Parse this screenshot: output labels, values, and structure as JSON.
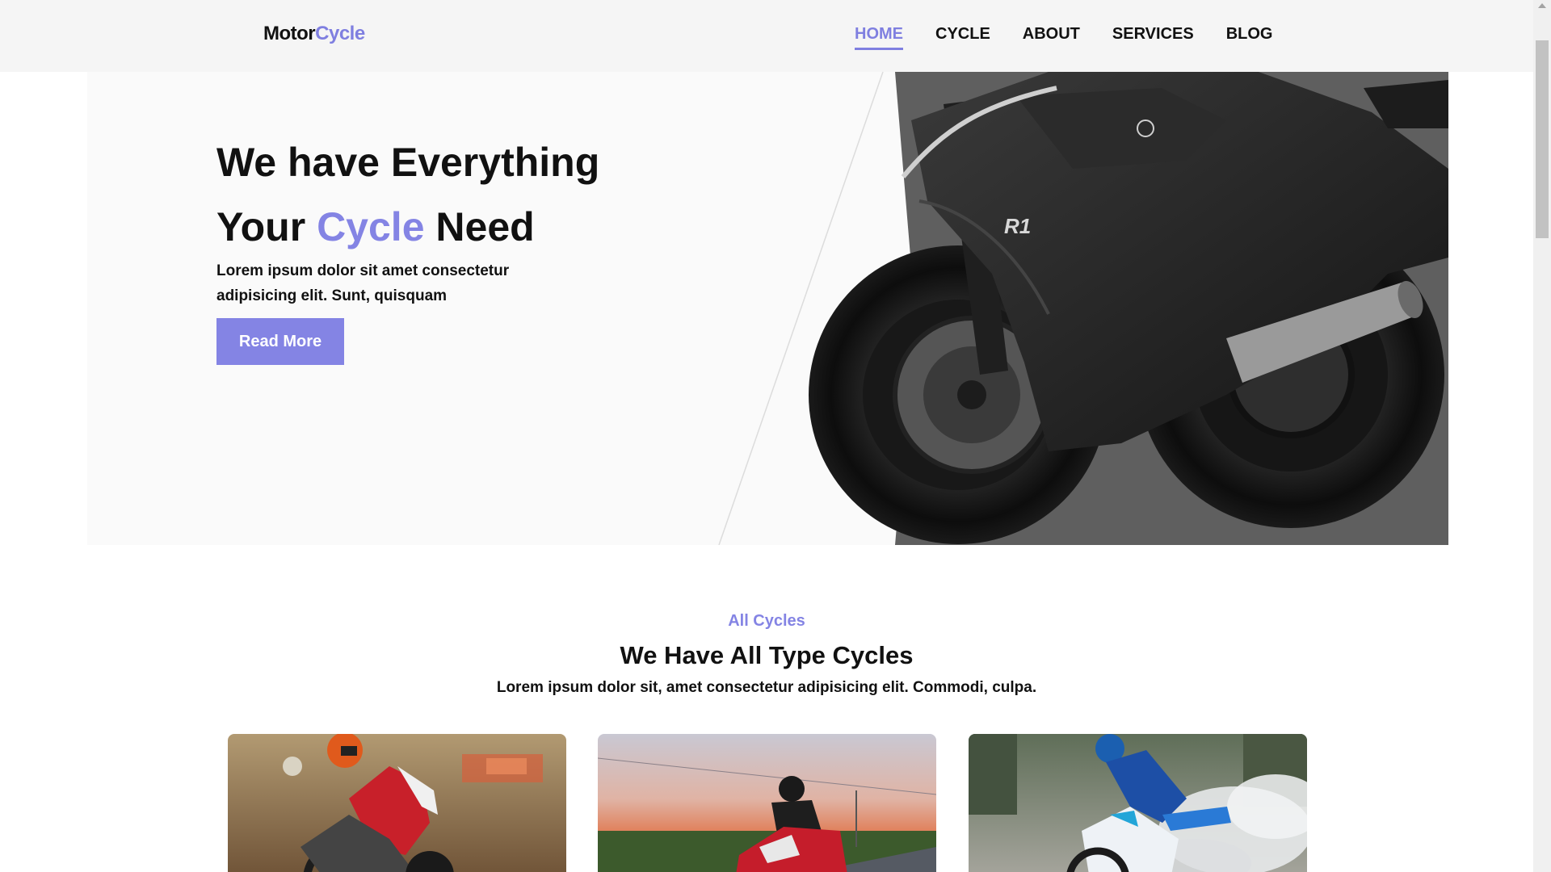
{
  "header": {
    "logo": {
      "part1": "Motor",
      "part2": "Cycle"
    },
    "nav": [
      {
        "label": "HOME",
        "active": true
      },
      {
        "label": "CYCLE",
        "active": false
      },
      {
        "label": "ABOUT",
        "active": false
      },
      {
        "label": "SERVICES",
        "active": false
      },
      {
        "label": "BLOG",
        "active": false
      }
    ]
  },
  "hero": {
    "title_line1": "We have Everything",
    "title_line2_start": "Your ",
    "title_line2_accent": "Cycle",
    "title_line2_end": " Need",
    "text": "Lorem ipsum dolor sit amet consectetur adipisicing elit. Sunt, quisquam",
    "button_label": "Read More",
    "bike_badge": "R1"
  },
  "section": {
    "tag": "All Cycles",
    "title": "We Have All Type Cycles",
    "text": "Lorem ipsum dolor sit, amet consectetur adipisicing elit. Commodi, culpa."
  },
  "colors": {
    "accent": "#8484e4",
    "header_bg": "#f5f5f5",
    "hero_bg": "#fafafa"
  }
}
